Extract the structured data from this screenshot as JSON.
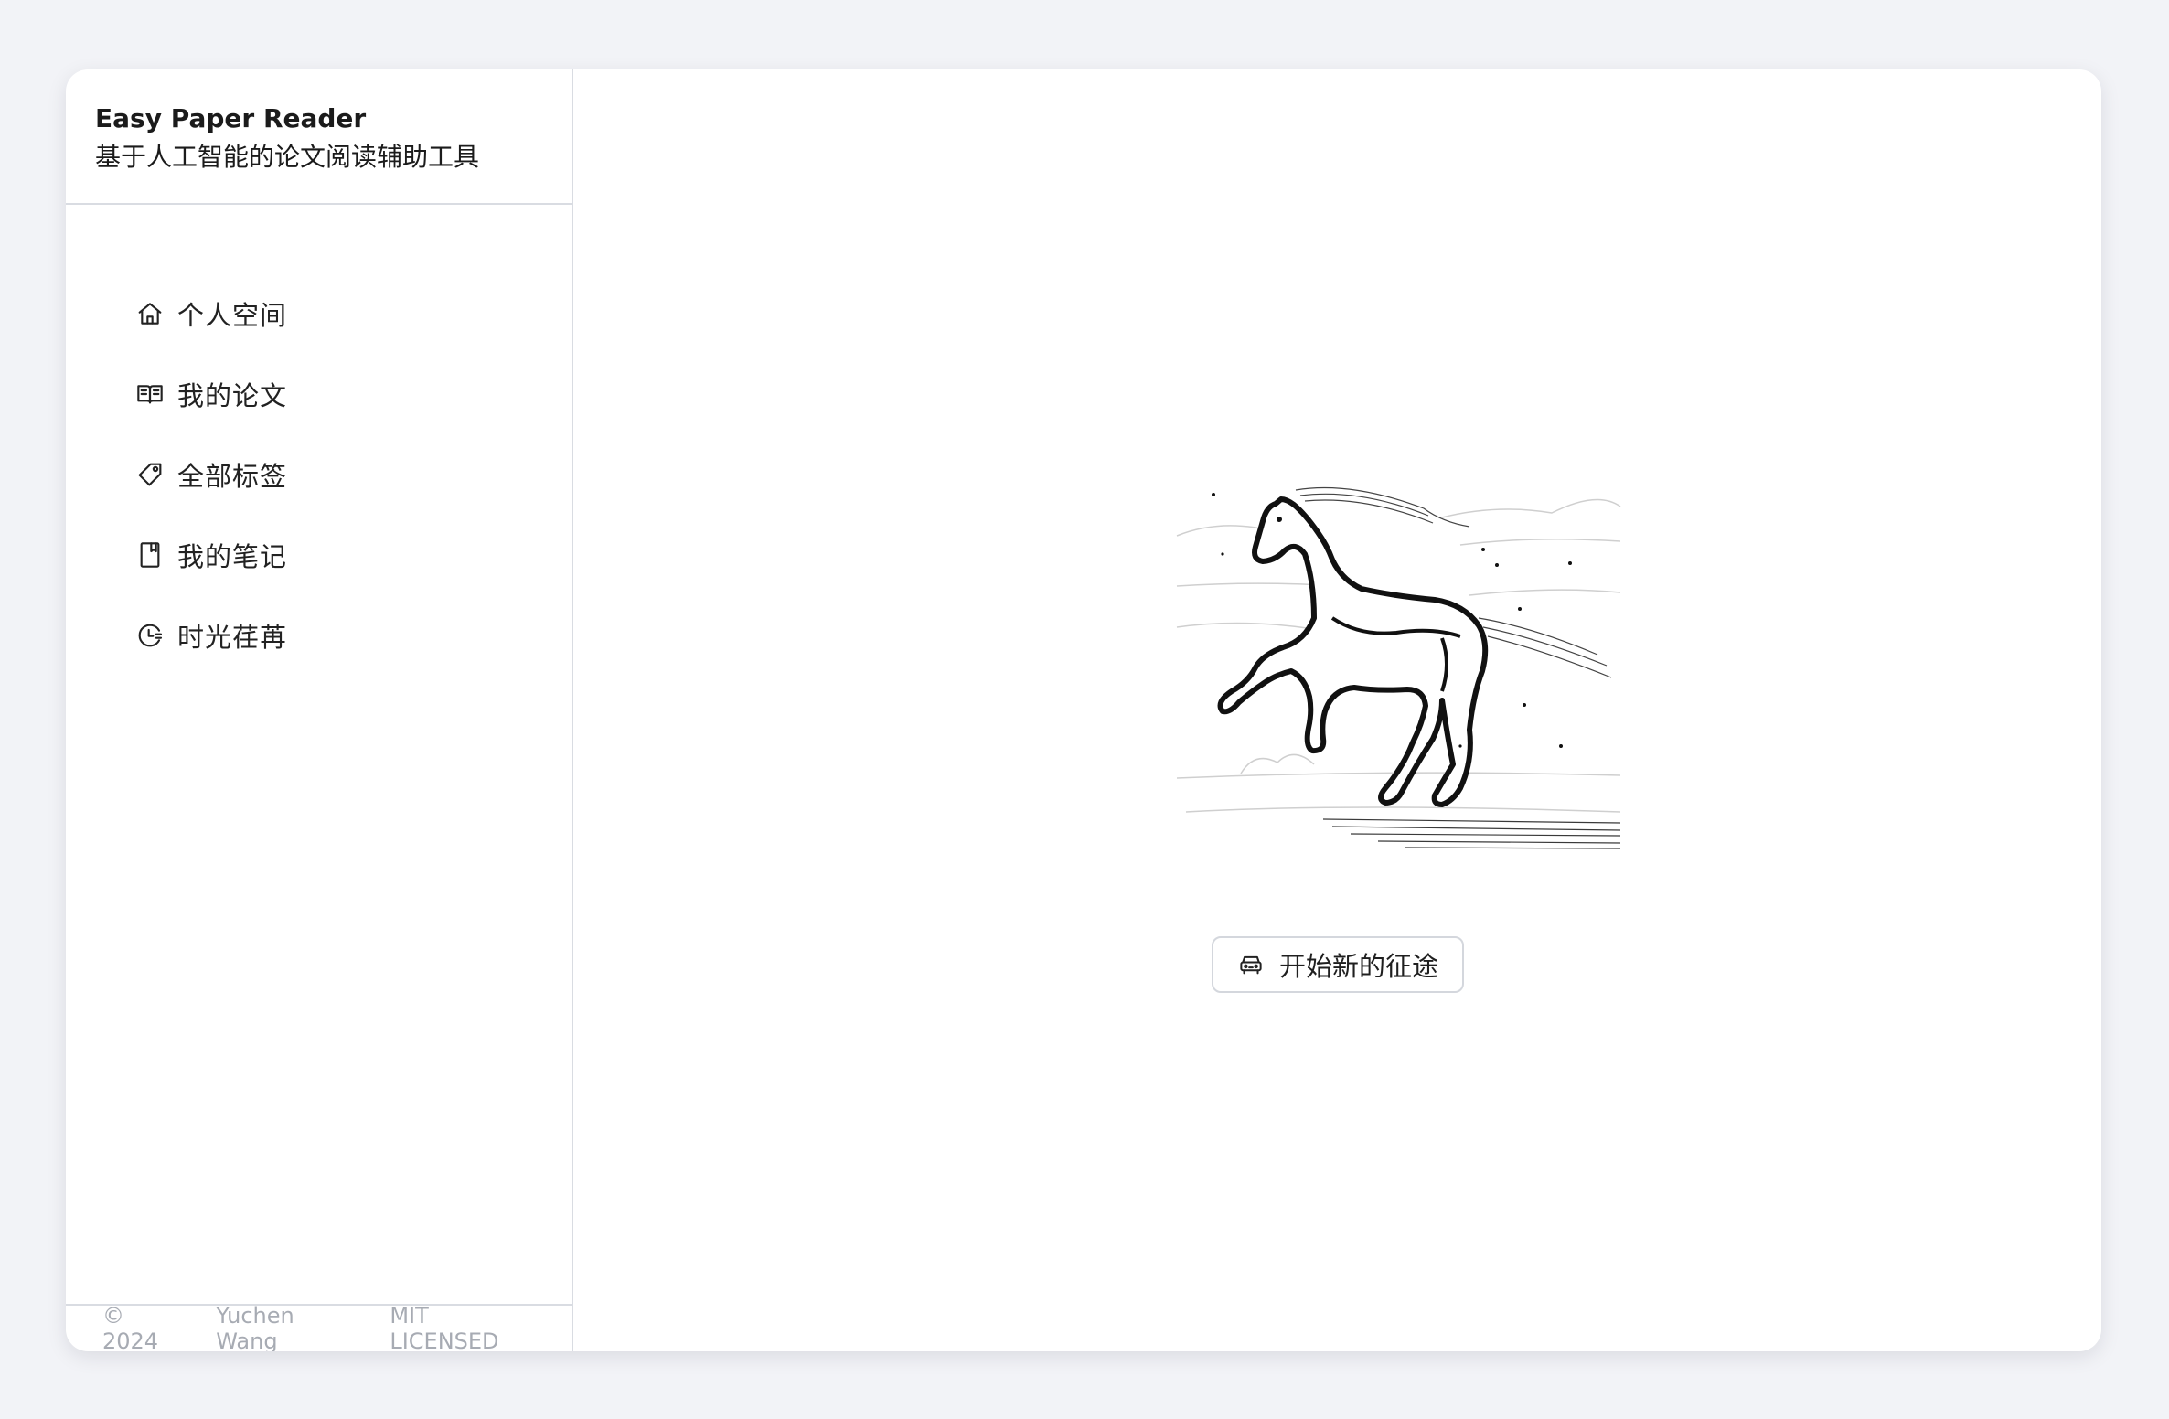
{
  "app": {
    "title": "Easy Paper Reader",
    "subtitle": "基于人工智能的论文阅读辅助工具"
  },
  "sidebar": {
    "items": [
      {
        "label": "个人空间",
        "icon": "home-icon"
      },
      {
        "label": "我的论文",
        "icon": "book-icon"
      },
      {
        "label": "全部标签",
        "icon": "tag-icon"
      },
      {
        "label": "我的笔记",
        "icon": "notebook-icon"
      },
      {
        "label": "时光荏苒",
        "icon": "history-icon"
      }
    ]
  },
  "main": {
    "illustration": "galloping-horse-sketch",
    "start_button": {
      "label": "开始新的征途",
      "icon": "car-icon"
    }
  },
  "footer": {
    "copyright": "© 2024",
    "author": "Yuchen Wang",
    "license": "MIT LICENSED"
  },
  "colors": {
    "page_background": "#f2f3f7",
    "card_background": "#ffffff",
    "divider": "#d9dce2",
    "footer_text": "#a7abb3"
  }
}
